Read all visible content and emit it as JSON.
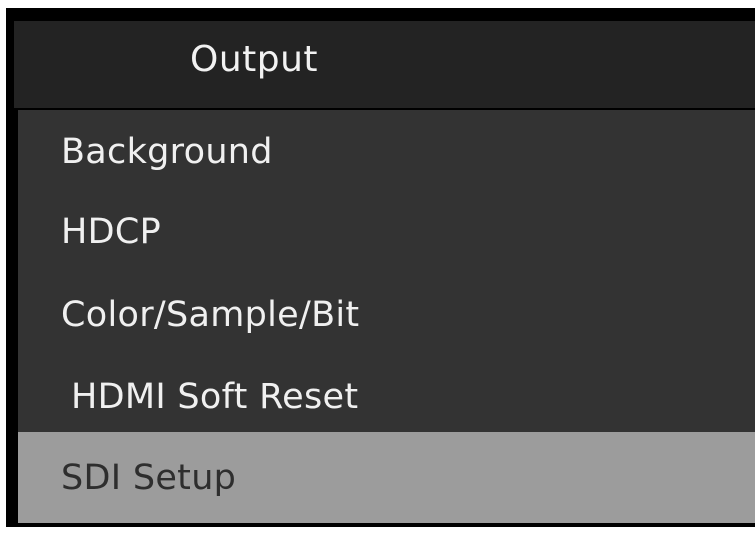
{
  "window": {
    "title": "Output"
  },
  "menu": {
    "items": [
      {
        "label": "Background",
        "selected": false
      },
      {
        "label": "HDCP",
        "selected": false
      },
      {
        "label": "Color/Sample/Bit",
        "selected": false
      },
      {
        "label": "HDMI Soft Reset",
        "selected": false
      },
      {
        "label": "SDI Setup",
        "selected": true
      }
    ]
  },
  "colors": {
    "frame": "#000000",
    "header_bg": "#232323",
    "menu_bg": "#333333",
    "selected_bg": "#9c9c9c",
    "text": "#f0f0f0",
    "selected_text": "#2e2e2e"
  }
}
